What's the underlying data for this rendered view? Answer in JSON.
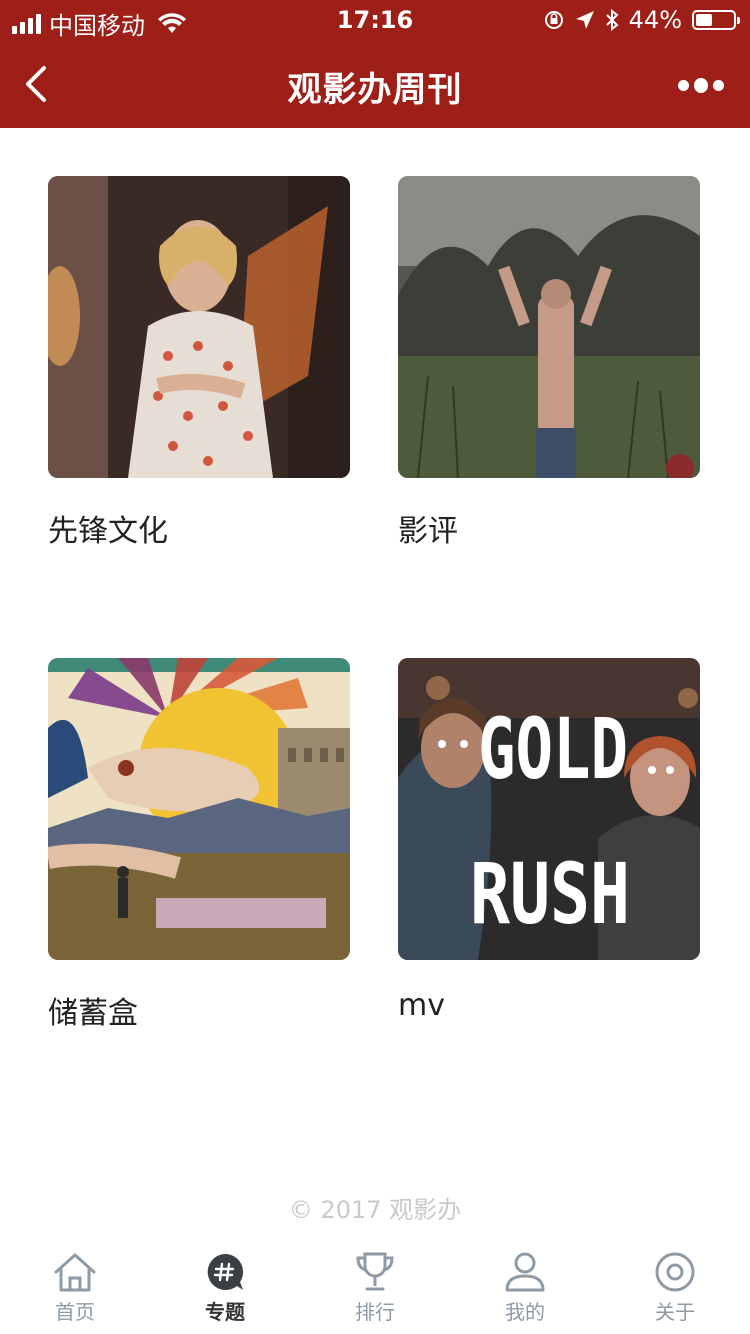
{
  "status_bar": {
    "carrier": "中国移动",
    "time": "17:16",
    "battery": "44%",
    "battery_level": 0.44
  },
  "nav": {
    "title": "观影办周刊",
    "back_icon": "chevron-left-icon",
    "more_icon": "more-dots-icon"
  },
  "topics": [
    {
      "label": "先锋文化",
      "image": "woman-in-floral-dress-photo"
    },
    {
      "label": "影评",
      "image": "man-arms-raised-in-field-photo"
    },
    {
      "label": "储蓄盒",
      "image": "surreal-collage-photo"
    },
    {
      "label": "mv",
      "image": "gold-rush-mv-cover",
      "cover_text_1": "GOLD",
      "cover_text_2": "RUSH"
    }
  ],
  "footer": {
    "copyright": "© 2017 观影办"
  },
  "tabbar": {
    "tabs": [
      {
        "label": "首页",
        "icon": "home-icon",
        "active": false
      },
      {
        "label": "专题",
        "icon": "hashtag-bubble-icon",
        "active": true
      },
      {
        "label": "排行",
        "icon": "trophy-icon",
        "active": false
      },
      {
        "label": "我的",
        "icon": "user-icon",
        "active": false
      },
      {
        "label": "关于",
        "icon": "about-circle-icon",
        "active": false
      }
    ]
  },
  "colors": {
    "brand": "#9e1f18",
    "tab_inactive": "#8e9aa6",
    "tab_active": "#333333"
  }
}
